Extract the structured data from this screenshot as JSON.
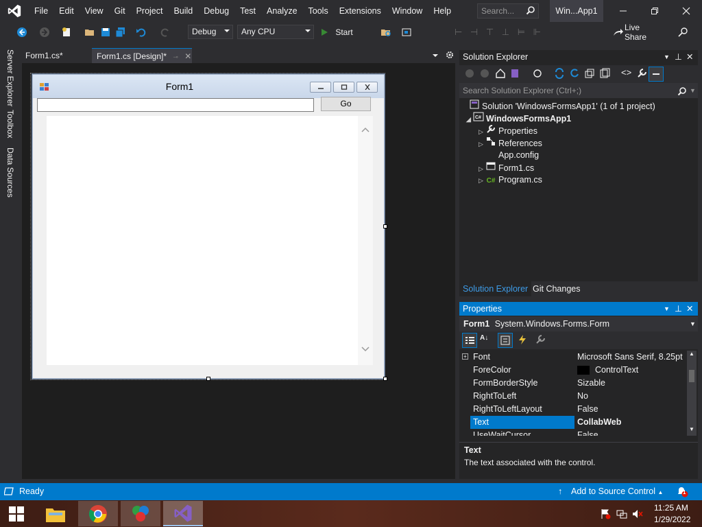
{
  "menu": [
    "File",
    "Edit",
    "View",
    "Git",
    "Project",
    "Build",
    "Debug",
    "Test",
    "Analyze",
    "Tools",
    "Extensions",
    "Window",
    "Help"
  ],
  "search": {
    "placeholder": "Search..."
  },
  "window_title": "Win...App1",
  "toolbar": {
    "config": "Debug",
    "platform": "Any CPU",
    "start": "Start",
    "live_share": "Live Share"
  },
  "side_tabs": [
    "Server Explorer",
    "Toolbox",
    "Data Sources"
  ],
  "doc_tabs": [
    {
      "label": "Form1.cs*"
    },
    {
      "label": "Form1.cs [Design]*"
    }
  ],
  "form": {
    "title": "Form1",
    "go_label": "Go",
    "url_value": ""
  },
  "solution_explorer": {
    "title": "Solution Explorer",
    "search_placeholder": "Search Solution Explorer (Ctrl+;)",
    "items": [
      {
        "label": "Solution 'WindowsFormsApp1' (1 of 1 project)"
      },
      {
        "label": "WindowsFormsApp1"
      },
      {
        "label": "Properties"
      },
      {
        "label": "References"
      },
      {
        "label": "App.config"
      },
      {
        "label": "Form1.cs"
      },
      {
        "label": "Program.cs"
      }
    ],
    "tabs": [
      "Solution Explorer",
      "Git Changes"
    ]
  },
  "properties": {
    "title": "Properties",
    "object_name": "Form1",
    "object_type": "System.Windows.Forms.Form",
    "rows": [
      {
        "name": "Font",
        "value": "Microsoft Sans Serif, 8.25pt"
      },
      {
        "name": "ForeColor",
        "value": "ControlText"
      },
      {
        "name": "FormBorderStyle",
        "value": "Sizable"
      },
      {
        "name": "RightToLeft",
        "value": "No"
      },
      {
        "name": "RightToLeftLayout",
        "value": "False"
      },
      {
        "name": "Text",
        "value": "CollabWeb"
      },
      {
        "name": "UseWaitCursor",
        "value": "False"
      }
    ],
    "desc_title": "Text",
    "desc_text": "The text associated with the control."
  },
  "status": {
    "text": "Ready",
    "source_control": "Add to Source Control",
    "notifications": "1"
  },
  "taskbar": {
    "time": "11:25 AM",
    "date": "1/29/2022"
  },
  "colors": {
    "accent": "#007acc",
    "vs_purple": "#865fc5",
    "background": "#2d2d30"
  }
}
